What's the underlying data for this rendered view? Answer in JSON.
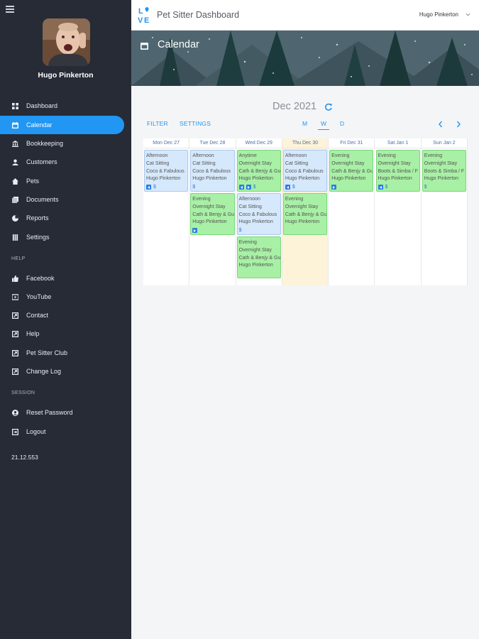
{
  "sidebar": {
    "user_name": "Hugo Pinkerton",
    "nav": [
      {
        "label": "Dashboard",
        "icon": "dashboard-icon"
      },
      {
        "label": "Calendar",
        "icon": "calendar-icon",
        "active": true
      },
      {
        "label": "Bookkeeping",
        "icon": "bank-icon"
      },
      {
        "label": "Customers",
        "icon": "person-icon"
      },
      {
        "label": "Pets",
        "icon": "house-icon"
      },
      {
        "label": "Documents",
        "icon": "documents-icon"
      },
      {
        "label": "Reports",
        "icon": "chart-icon"
      },
      {
        "label": "Settings",
        "icon": "sliders-icon"
      }
    ],
    "help_label": "HELP",
    "help": [
      {
        "label": "Facebook",
        "icon": "thumbs-up-icon"
      },
      {
        "label": "YouTube",
        "icon": "video-icon"
      },
      {
        "label": "Contact",
        "icon": "external-link-icon"
      },
      {
        "label": "Help",
        "icon": "external-link-icon"
      },
      {
        "label": "Pet Sitter Club",
        "icon": "external-link-icon"
      },
      {
        "label": "Change Log",
        "icon": "external-link-icon"
      }
    ],
    "session_label": "SESSION",
    "session": [
      {
        "label": "Reset Password",
        "icon": "user-circle-icon"
      },
      {
        "label": "Logout",
        "icon": "logout-icon"
      }
    ],
    "version": "21.12.553"
  },
  "topbar": {
    "logo_text": "LOVE",
    "title": "Pet Sitter Dashboard",
    "user": "Hugo Pinkerton"
  },
  "banner": {
    "title": "Calendar"
  },
  "calendar": {
    "month": "Dec 2021",
    "filter_label": "FILTER",
    "settings_label": "SETTINGS",
    "views": [
      "M",
      "W",
      "D"
    ],
    "active_view": "W",
    "days": [
      {
        "label": "Mon Dec 27",
        "today": false,
        "events": [
          {
            "color": "blue",
            "time": "Afternoon",
            "service": "Cat Sitting",
            "pets": "Coco & Fabulous",
            "sitter": "Hugo Pinkerton",
            "icons": [
              "back"
            ]
          }
        ]
      },
      {
        "label": "Tue Dec 28",
        "today": false,
        "events": [
          {
            "color": "blue",
            "time": "Afternoon",
            "service": "Cat Sitting",
            "pets": "Coco & Fabulous",
            "sitter": "Hugo Pinkerton",
            "icons": []
          },
          {
            "color": "green",
            "time": "Evening",
            "service": "Overnight Stay",
            "pets": "Cath & Benjy & Gu",
            "sitter": "Hugo Pinkerton",
            "icons": [
              "play"
            ],
            "no_dollar": true
          }
        ]
      },
      {
        "label": "Wed Dec 29",
        "today": false,
        "events": [
          {
            "color": "green",
            "time": "Anytime",
            "service": "Overnight Stay",
            "pets": "Cath & Benjy & Gu",
            "sitter": "Hugo Pinkerton",
            "icons": [
              "back",
              "play"
            ]
          },
          {
            "color": "blue",
            "time": "Afternoon",
            "service": "Cat Sitting",
            "pets": "Coco & Fabulous",
            "sitter": "Hugo Pinkerton",
            "icons": []
          },
          {
            "color": "green",
            "time": "Evening",
            "service": "Overnight Stay",
            "pets": "Cath & Benjy & Gu",
            "sitter": "Hugo Pinkerton",
            "icons": [],
            "no_icons_row": true
          }
        ]
      },
      {
        "label": "Thu Dec 30",
        "today": true,
        "events": [
          {
            "color": "blue",
            "time": "Afternoon",
            "service": "Cat Sitting",
            "pets": "Coco & Fabulous",
            "sitter": "Hugo Pinkerton",
            "icons": [
              "back"
            ]
          },
          {
            "color": "green",
            "time": "Evening",
            "service": "Overnight Stay",
            "pets": "Cath & Benjy & Gu",
            "sitter": "Hugo Pinkerton",
            "icons": [],
            "no_icons_row": true
          }
        ]
      },
      {
        "label": "Fri Dec 31",
        "today": false,
        "events": [
          {
            "color": "green",
            "time": "Evening",
            "service": "Overnight Stay",
            "pets": "Cath & Benjy & Gu",
            "sitter": "Hugo Pinkerton",
            "icons": [
              "play"
            ],
            "no_dollar": true
          }
        ]
      },
      {
        "label": "Sat Jan 1",
        "today": false,
        "events": [
          {
            "color": "green",
            "time": "Evening",
            "service": "Overnight Stay",
            "pets": "Boots & Simba / F",
            "sitter": "Hugo Pinkerton",
            "icons": [
              "back"
            ]
          }
        ]
      },
      {
        "label": "Sun Jan 2",
        "today": false,
        "events": [
          {
            "color": "green",
            "time": "Evening",
            "service": "Overnight Stay",
            "pets": "Boots & Simba / F",
            "sitter": "Hugo Pinkerton",
            "icons": []
          }
        ]
      }
    ]
  }
}
